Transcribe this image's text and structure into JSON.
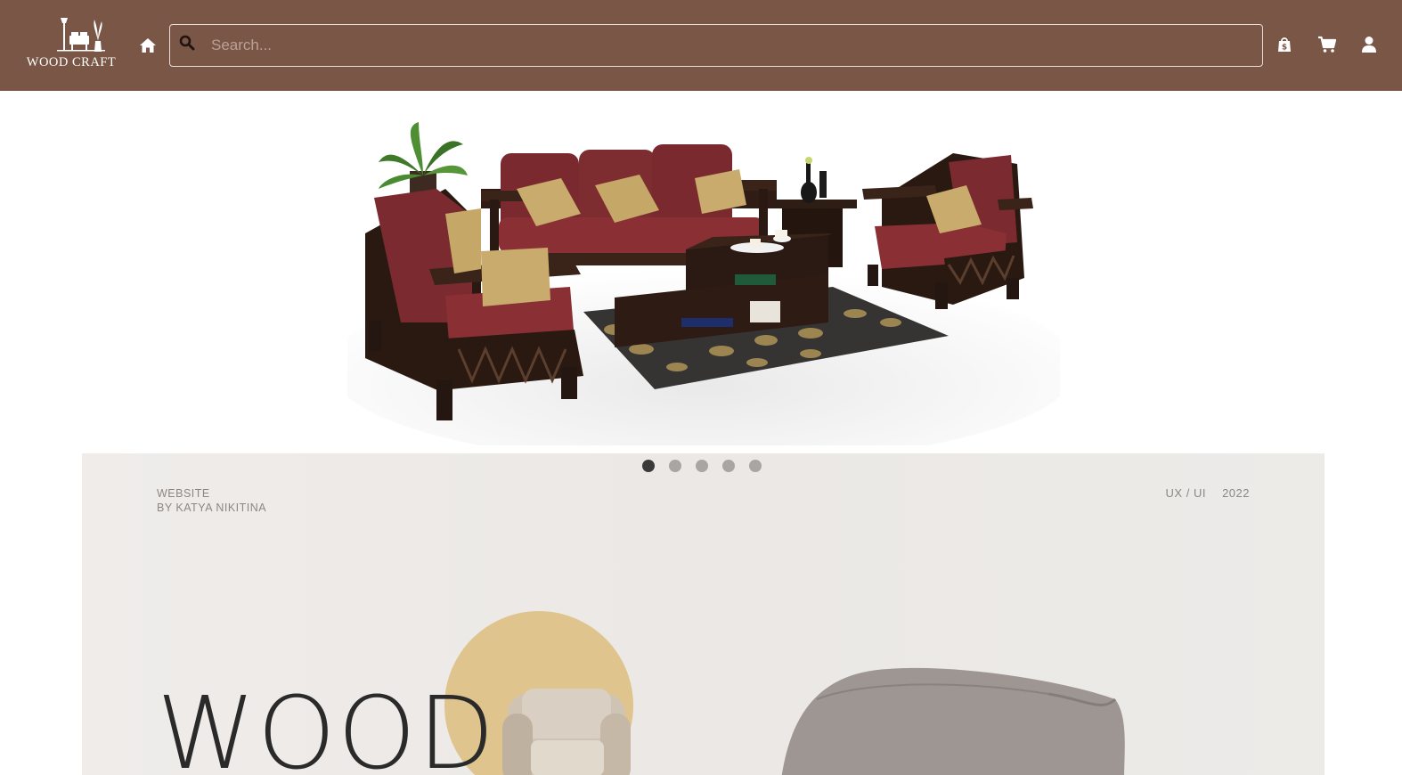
{
  "header": {
    "logo_text": "WOOD CRAFT",
    "search_placeholder": "Search...",
    "icons": [
      "home-icon",
      "search-icon",
      "shopping-bag-icon",
      "cart-icon",
      "user-icon"
    ],
    "colors": {
      "header_bg": "#7a5646",
      "accent_yellow": "#dfc58d"
    }
  },
  "hero": {
    "image": "dark wood sofa set with maroon cushions and coffee table"
  },
  "carousel": {
    "slide_count": 5,
    "active_index": 0
  },
  "banner": {
    "meta_left_line1": "WEBSITE",
    "meta_left_line2": "BY KATYA NIKITINA",
    "meta_tag": "UX / UI",
    "meta_year": "2022",
    "title": "WOOD"
  }
}
